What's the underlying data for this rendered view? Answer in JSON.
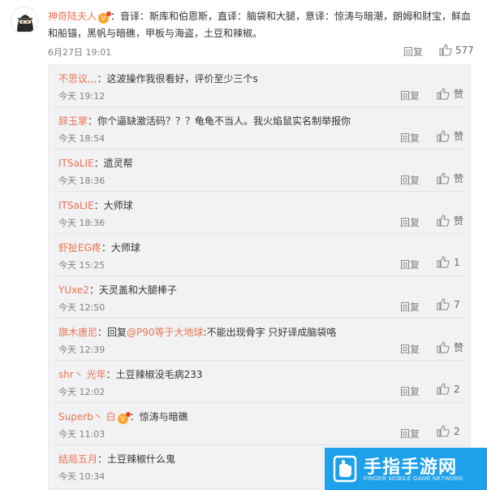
{
  "main": {
    "username": "神奇陆夫人",
    "text": "：音译：斯库和伯恩斯，直译：脑袋和大腿，意译：惊涛与暗潮，朗姆和财宝，鲜血和船锚，黑帆与暗礁，甲板与海盗，土豆和辣椒。",
    "time": "6月27日 19:01",
    "reply_label": "回复",
    "likes": "577"
  },
  "replies": [
    {
      "username": "不思议,,,",
      "text": "：这波操作我很看好，评价至少三个s",
      "time": "今天 19:12",
      "reply_label": "回复",
      "likes": "赞"
    },
    {
      "username": "辞玉掌",
      "text": "：你个逼缺激活码？？？龟龟不当人。我火焰鼠实名制举报你",
      "time": "今天 18:54",
      "reply_label": "回复",
      "likes": "赞"
    },
    {
      "username": "ITSaLIE",
      "text": "：遗灵帮",
      "time": "今天 18:36",
      "reply_label": "回复",
      "likes": "赞"
    },
    {
      "username": "ITSaLIE",
      "text": "：大师球",
      "time": "今天 18:36",
      "reply_label": "回复",
      "likes": "赞"
    },
    {
      "username": "虾扯EG疼",
      "text": "：大师球",
      "time": "今天 15:25",
      "reply_label": "回复",
      "likes": "1"
    },
    {
      "username": "YUxe2",
      "text": "：天灵盖和大腿棒子",
      "time": "今天 12:50",
      "reply_label": "回复",
      "likes": "7"
    },
    {
      "username": "旗木唐尼",
      "text_prefix": "：回复",
      "mention": "@P90等于大地球",
      "text": ":不能出现骨字 只好译成脑袋咯",
      "time": "今天 12:39",
      "reply_label": "回复",
      "likes": "赞"
    },
    {
      "username": "shr丶 光年",
      "text": "：土豆辣椒没毛病233",
      "time": "今天 12:02",
      "reply_label": "回复",
      "likes": "2"
    },
    {
      "username": "Superb丶 白",
      "text": "：惊涛与暗礁",
      "time": "今天 11:03",
      "reply_label": "回复",
      "likes": "2"
    },
    {
      "username": "结局五月",
      "text": "：土豆辣椒什么鬼",
      "time": "今天 10:34",
      "reply_label": "",
      "likes": ""
    }
  ],
  "watermark": {
    "title": "手指手游网",
    "subtitle": "FINGER MOBILE GAME NETWORK"
  }
}
